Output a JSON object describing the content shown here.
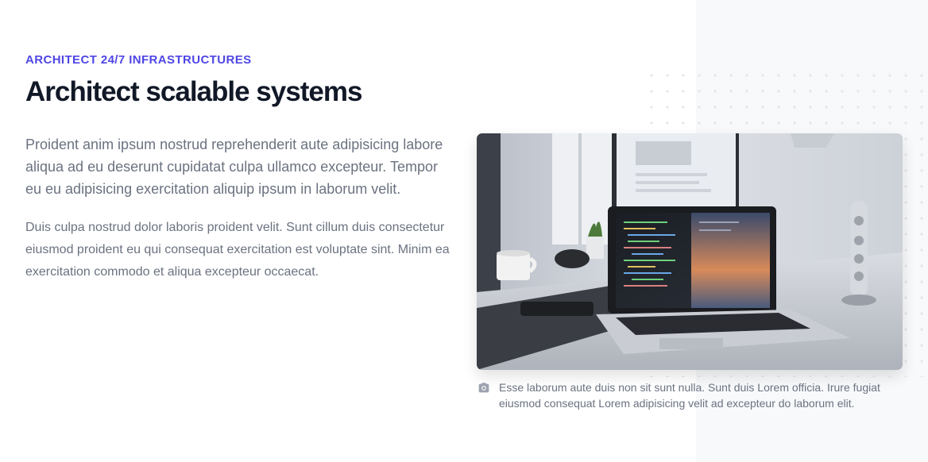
{
  "feature": {
    "eyebrow": "Architect 24/7 infrastructures",
    "title": "Architect scalable systems",
    "lead": "Proident anim ipsum nostrud reprehenderit aute adipisicing labore aliqua ad eu deserunt cupidatat culpa ullamco excepteur. Tempor eu eu adipisicing exercitation aliquip ipsum in laborum velit.",
    "body": "Duis culpa nostrud dolor laboris proident velit. Sunt cillum duis consectetur eiusmod proident eu qui consequat exercitation est voluptate sint. Minim ea exercitation commodo et aliqua excepteur occaecat."
  },
  "figure": {
    "caption": "Esse laborum aute duis non sit sunt nulla. Sunt duis Lorem officia. Irure fugiat eiusmod consequat Lorem adipisicing velit ad excepteur do laborum elit.",
    "caption_icon": "camera-icon"
  },
  "colors": {
    "accent": "#4f46e5",
    "heading": "#111827",
    "text": "#6b7280",
    "panel_bg": "#f8f9fb"
  }
}
